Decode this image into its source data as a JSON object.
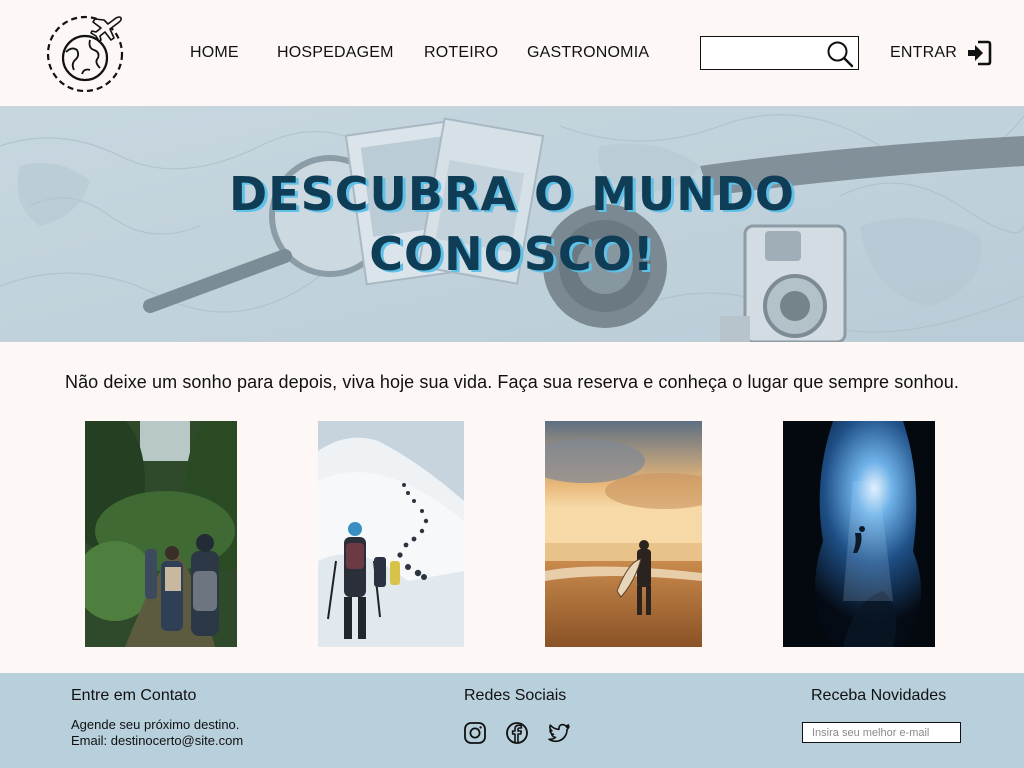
{
  "header": {
    "logo_icon": "globe-plane-logo-icon",
    "nav": [
      {
        "label": "HOME"
      },
      {
        "label": "HOSPEDAGEM"
      },
      {
        "label": "ROTEIRO"
      },
      {
        "label": "GASTRONOMIA"
      }
    ],
    "search": {
      "placeholder": "",
      "icon": "search-icon"
    },
    "login": {
      "label": "ENTRAR",
      "icon": "sign-in-icon"
    }
  },
  "hero": {
    "title_line1": "DESCUBRA O MUNDO",
    "title_line2": "CONOSCO!",
    "title_color": "#0f3d56",
    "title_shadow_color": "#5fc0e8"
  },
  "intro": {
    "text": "Não deixe um sonho para depois, viva hoje sua vida. Faça sua reserva e conheça o lugar que sempre sonhou."
  },
  "gallery": [
    {
      "subject": "forest-hikers-photo"
    },
    {
      "subject": "snow-mountain-hikers-photo"
    },
    {
      "subject": "beach-surfer-sunset-photo"
    },
    {
      "subject": "underwater-cave-diver-photo"
    }
  ],
  "footer": {
    "background": "#b8cfdc",
    "contact": {
      "title": "Entre em Contato",
      "line1": "Agende seu próximo destino.",
      "line2": "Email: destinocerto@site.com"
    },
    "social": {
      "title": "Redes Sociais",
      "icons": [
        "instagram-icon",
        "facebook-icon",
        "twitter-icon"
      ]
    },
    "newsletter": {
      "title": "Receba Novidades",
      "placeholder": "Insira seu melhor e-mail"
    }
  }
}
